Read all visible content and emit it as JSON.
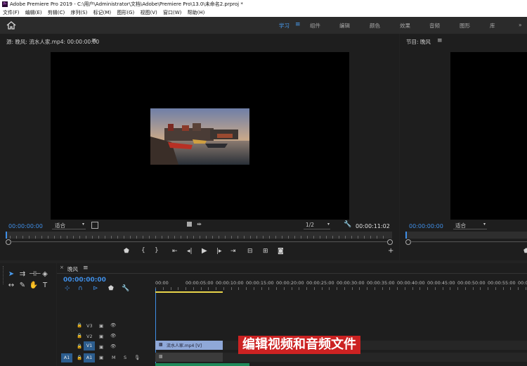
{
  "app": {
    "title": "Adobe Premiere Pro 2019 - C:\\用户\\Administrator\\文档\\Adobe\\Premiere Pro\\13.0\\未命名2.prproj *",
    "icon_text": "Pr"
  },
  "menu": [
    "文件(F)",
    "编辑(E)",
    "剪辑(C)",
    "序列(S)",
    "标记(M)",
    "图形(G)",
    "视图(V)",
    "窗口(W)",
    "帮助(H)"
  ],
  "workspaces": {
    "active": "学习",
    "items": [
      "组件",
      "编辑",
      "颜色",
      "效果",
      "音频",
      "图形",
      "库"
    ],
    "more": "»"
  },
  "source_panel": {
    "title": "源: 晚风: 流水人家.mp4: 00:00:00:00",
    "timecode_in": "00:00:00:00",
    "fit": "适合",
    "resolution": "1/2",
    "duration": "00:00:11:02"
  },
  "program_panel": {
    "title": "节目: 晚风",
    "timecode": "00:00:00:00",
    "fit": "适合"
  },
  "timeline": {
    "tab": "晚风",
    "timecode": "00:00:00:00",
    "ruler_labels": [
      "00:00",
      "00:00:05:00",
      "00:00:10:00",
      "00:00:15:00",
      "00:00:20:00",
      "00:00:25:00",
      "00:00:30:00",
      "00:00:35:00",
      "00:00:40:00",
      "00:00:45:00",
      "00:00:50:00",
      "00:00:55:00",
      "00:01"
    ],
    "tracks": [
      {
        "name": "V3"
      },
      {
        "name": "V2"
      },
      {
        "name": "V1"
      }
    ],
    "audio_track": {
      "src": "A1",
      "name": "A1",
      "m": "M",
      "s": "S"
    },
    "clip_label": "流水人家.mp4 [V]"
  },
  "overlay_caption": "编辑视频和音频文件",
  "colors": {
    "accent": "#4a9cf0",
    "timecode_blue": "#3f8fe8",
    "caption_red": "#cc2222",
    "clip_video": "#8fa8d8",
    "clip_audio": "#1f8a5a"
  }
}
